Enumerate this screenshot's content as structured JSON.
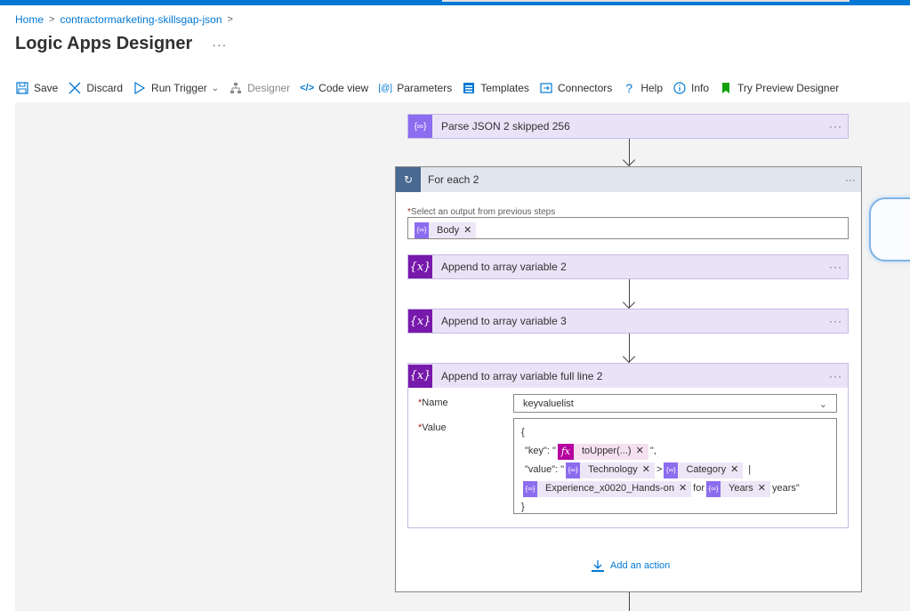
{
  "breadcrumb": {
    "home": "Home",
    "resource": "contractormarketing-skillsgap-json"
  },
  "page": {
    "title": "Logic Apps Designer",
    "more": "···"
  },
  "toolbar": {
    "save": "Save",
    "discard": "Discard",
    "run_trigger": "Run Trigger",
    "designer": "Designer",
    "code_view": "Code view",
    "parameters": "Parameters",
    "templates": "Templates",
    "connectors": "Connectors",
    "help": "Help",
    "info": "Info",
    "preview": "Try Preview Designer"
  },
  "steps": {
    "parse_json": {
      "title": "Parse JSON 2 skipped 256",
      "dots": "···"
    },
    "foreach": {
      "title": "For each 2",
      "dots": "···",
      "select_label": "Select an output from previous steps",
      "required": "*",
      "token": "Body"
    },
    "append2": {
      "title": "Append to array variable 2",
      "dots": "···"
    },
    "append3": {
      "title": "Append to array variable 3",
      "dots": "···"
    },
    "append_full": {
      "title": "Append to array variable full line 2",
      "dots": "···",
      "name_label": "Name",
      "value_label": "Value",
      "name_value": "keyvaluelist",
      "value": {
        "open": "{",
        "key_prefix": "\"key\": \"",
        "fx_token": "toUpper(...)",
        "key_suffix": "\",",
        "value_prefix": "\"value\": \"",
        "tech_token": "Technology",
        "gt": ">",
        "category_token": "Category",
        "pipe": "|",
        "experience_token": "Experience_x0020_Hands-on",
        "for_text": "for",
        "years_token": "Years",
        "years_suffix": "years\"",
        "close": "}"
      }
    },
    "add_action": "Add an action"
  },
  "colors": {
    "accent": "#0078d4",
    "action_header": "#eae3f8",
    "parse_icon": "#8c6cef",
    "variable_icon": "#7719aa",
    "foreach_icon": "#486991",
    "fx_icon": "#b4009e"
  }
}
